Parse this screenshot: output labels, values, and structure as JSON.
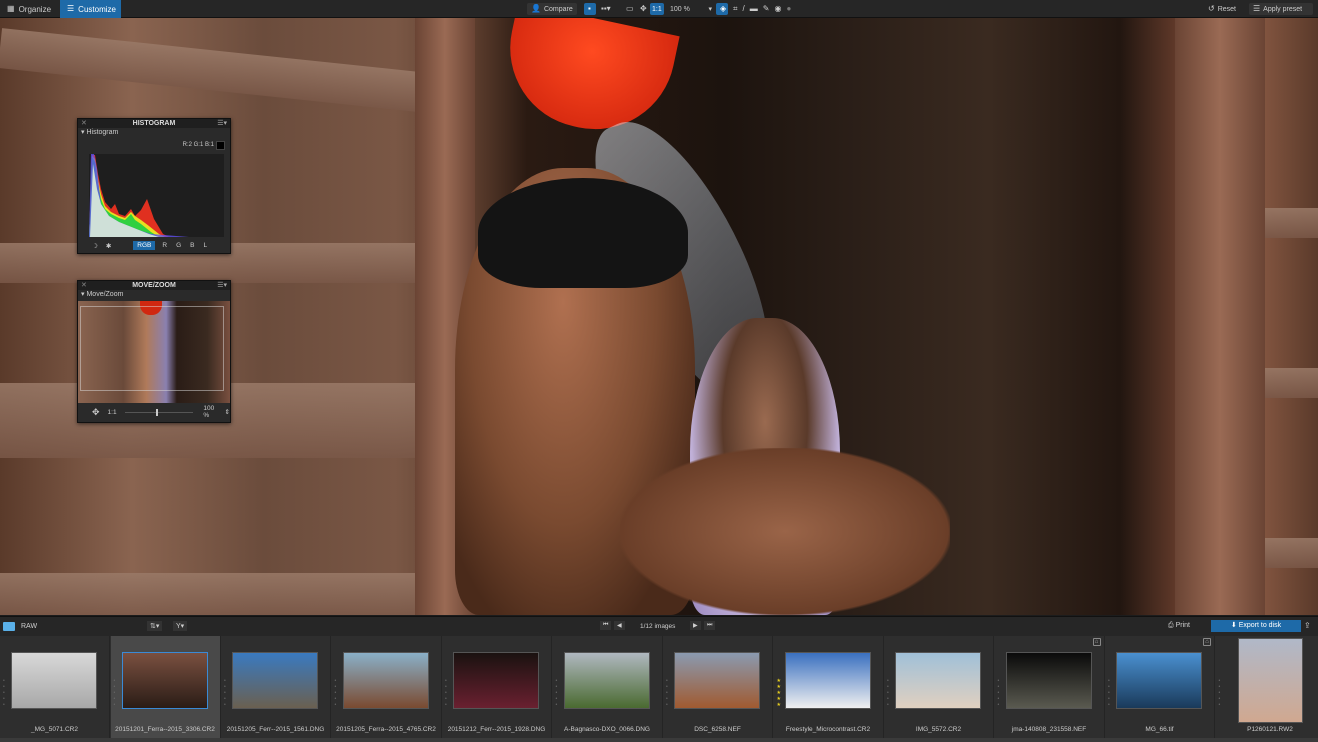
{
  "topbar": {
    "organize": "Organize",
    "customize": "Customize",
    "compare": "Compare",
    "one_to_one": "1:1",
    "zoom": "100 %",
    "reset": "Reset",
    "apply_preset": "Apply preset"
  },
  "histogram": {
    "title": "HISTOGRAM",
    "section": "Histogram",
    "readout": "R:2 G:1 B:1",
    "channels": [
      "RGB",
      "R",
      "G",
      "B",
      "L"
    ],
    "active_channel": "RGB"
  },
  "movezoom": {
    "title": "MOVE/ZOOM",
    "section": "Move/Zoom",
    "ratio": "1:1",
    "zoom": "100 %",
    "slider_value": 0.45
  },
  "filmstrip": {
    "folder": "RAW",
    "counter": "1/12 images",
    "print": "Print",
    "export": "Export to disk",
    "items": [
      {
        "name": "_MG_5071.CR2",
        "stars": 0,
        "selected": false,
        "c1": "#d8d8d8",
        "c2": "#a8a8a8"
      },
      {
        "name": "20151201_Ferra--2015_3306.CR2",
        "stars": 0,
        "selected": true,
        "c1": "#7a5040",
        "c2": "#2a1c16"
      },
      {
        "name": "20151205_Ferr--2015_1561.DNG",
        "stars": 0,
        "selected": false,
        "c1": "#3a7ac0",
        "c2": "#6a6050"
      },
      {
        "name": "20151205_Ferra--2015_4765.CR2",
        "stars": 0,
        "selected": false,
        "c1": "#8ab0c8",
        "c2": "#7a4a30"
      },
      {
        "name": "20151212_Ferr--2015_1928.DNG",
        "stars": 0,
        "selected": false,
        "c1": "#1a1210",
        "c2": "#6a2030"
      },
      {
        "name": "A-Bagnasco-DXO_0066.DNG",
        "stars": 0,
        "selected": false,
        "c1": "#b0b8c0",
        "c2": "#4a6a30"
      },
      {
        "name": "DSC_6258.NEF",
        "stars": 0,
        "selected": false,
        "c1": "#8a9ab0",
        "c2": "#a05a30"
      },
      {
        "name": "Freestyle_Microcontrast.CR2",
        "stars": 5,
        "selected": false,
        "c1": "#3a70c0",
        "c2": "#f0f0f0"
      },
      {
        "name": "IMG_5572.CR2",
        "stars": 0,
        "selected": false,
        "c1": "#a0c0d8",
        "c2": "#e0d0c0"
      },
      {
        "name": "jma-140808_231558.NEF",
        "stars": 0,
        "selected": false,
        "c1": "#0a0a0a",
        "c2": "#5a5a50"
      },
      {
        "name": "MG_66.tif",
        "stars": 0,
        "selected": false,
        "c1": "#4a90d0",
        "c2": "#1a3a5a"
      },
      {
        "name": "P1260121.RW2",
        "stars": 0,
        "selected": false,
        "c1": "#b0b8c8",
        "c2": "#d0a890"
      }
    ]
  }
}
